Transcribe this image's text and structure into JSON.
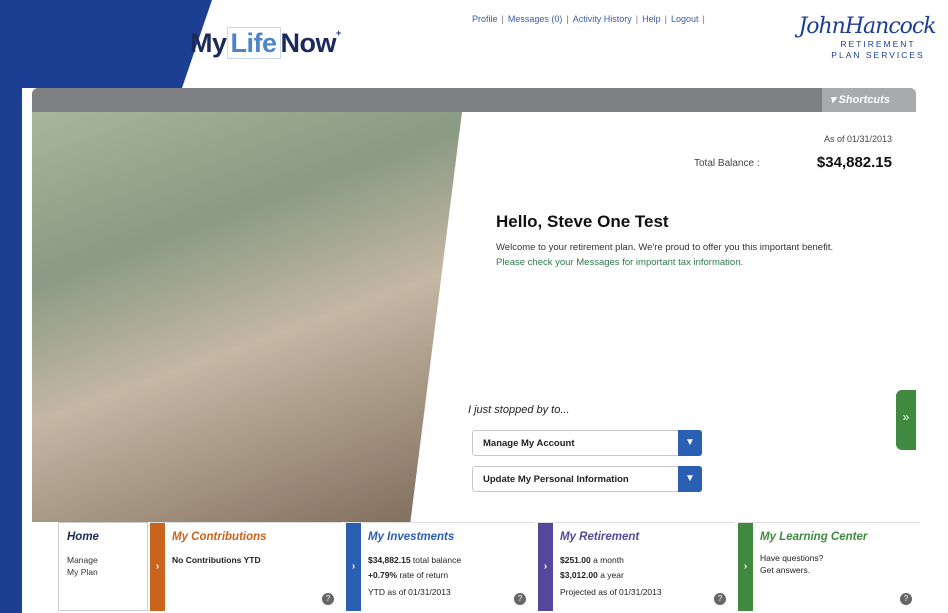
{
  "header": {
    "logo": {
      "my": "My",
      "life": "Life",
      "now": "Now",
      "tm": "+"
    },
    "nav": [
      "Profile",
      "Messages (0)",
      "Activity History",
      "Help",
      "Logout"
    ],
    "brand": {
      "script": "JohnHancock",
      "line1": "RETIREMENT",
      "line2": "PLAN SERVICES"
    }
  },
  "shortcuts": {
    "label": "▾ Shortcuts"
  },
  "hero": {
    "as_of": "As of 01/31/2013",
    "balance_label": "Total Balance :",
    "balance_value": "$34,882.15",
    "greeting": "Hello, Steve One Test",
    "welcome_text": "Welcome to your retirement plan. We're proud to offer you this important benefit. ",
    "welcome_link": "Please check your Messages for important tax information.",
    "stopped_by": "I just stopped by to...",
    "dropdown_manage": "Manage My Account",
    "dropdown_update": "Update My Personal Information",
    "side_arrow": "»"
  },
  "tiles": {
    "home": {
      "title": "Home",
      "line1": "Manage",
      "line2": "My Plan"
    },
    "contributions": {
      "title": "My Contributions",
      "line1": "No Contributions YTD"
    },
    "investments": {
      "title": "My Investments",
      "line1_value": "$34,882.15",
      "line1_label": " total balance",
      "line2_value": "+0.79%",
      "line2_label": " rate of return",
      "line3": "YTD as of 01/31/2013"
    },
    "retirement": {
      "title": "My Retirement",
      "line1_value": "$251.00",
      "line1_label": " a month",
      "line2_value": "$3,012.00",
      "line2_label": " a year",
      "line3": "Projected as of 01/31/2013"
    },
    "learning": {
      "title": "My Learning Center",
      "line1": "Have questions?",
      "line2": "Get answers."
    }
  },
  "colors": {
    "frame_blue": "#1d3f93",
    "contributions": "#c8641e",
    "investments": "#2b5fb3",
    "retirement": "#54489a",
    "learning": "#3f8a3f"
  }
}
